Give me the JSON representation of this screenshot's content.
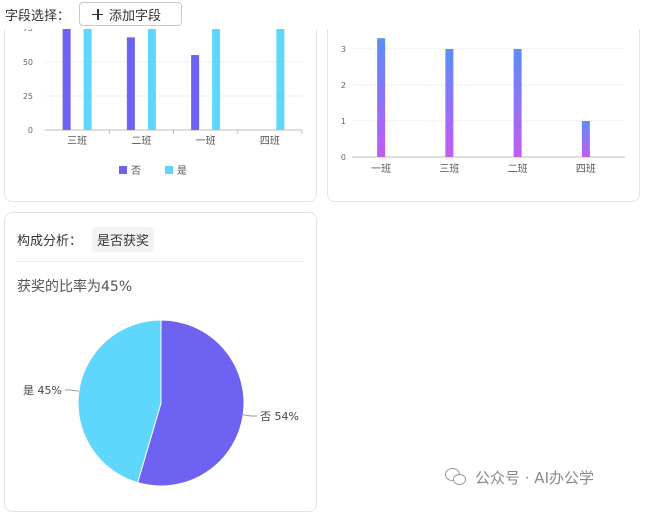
{
  "toolbar": {
    "field_select_label": "字段选择：",
    "add_field_label": "添加字段"
  },
  "colors": {
    "no": "#6e62f2",
    "yes": "#5fd6fb",
    "gradient_top": "#5b8ef5",
    "gradient_bottom": "#c25bf0"
  },
  "chart_data": [
    {
      "type": "bar",
      "categories": [
        "三班",
        "二班",
        "一班",
        "四班"
      ],
      "series": [
        {
          "name": "否",
          "values": [
            76,
            68,
            55,
            0
          ]
        },
        {
          "name": "是",
          "values": [
            76,
            76,
            76,
            76
          ]
        }
      ],
      "yticks": [
        0,
        25,
        50,
        75
      ],
      "ylim": [
        0,
        80
      ],
      "legend_position": "bottom-center",
      "grid": true
    },
    {
      "type": "bar",
      "categories": [
        "一班",
        "三班",
        "二班",
        "四班"
      ],
      "values": [
        3.3,
        3,
        3,
        1
      ],
      "yticks": [
        0,
        1,
        2,
        3
      ],
      "ylim": [
        0,
        3.4
      ],
      "grid": true
    },
    {
      "type": "pie",
      "title": "构成分析：",
      "field": "是否获奖",
      "subtitle": "获奖的比率为45%",
      "slices": [
        {
          "name": "否",
          "value": 54,
          "label": "否 54%"
        },
        {
          "name": "是",
          "value": 45,
          "label": "是 45%"
        }
      ]
    }
  ],
  "watermark": {
    "text": "公众号 · AI办公学"
  }
}
